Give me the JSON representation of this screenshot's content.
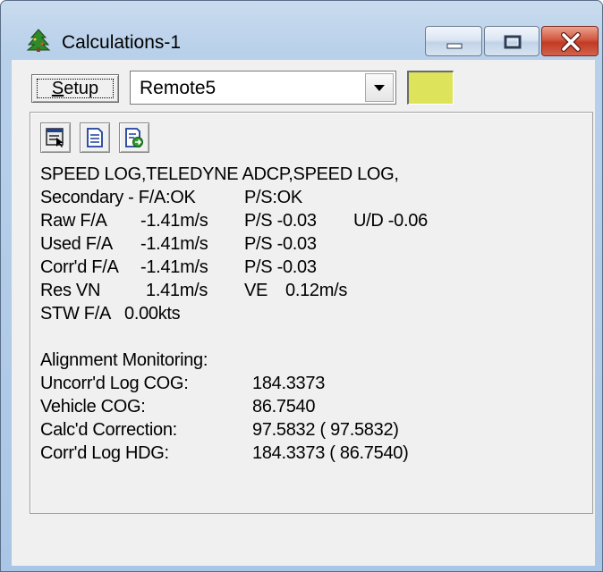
{
  "window": {
    "title": "Calculations-1"
  },
  "toolbar": {
    "setup_label_underlined": "S",
    "setup_label_rest": "etup",
    "source_value": "Remote5",
    "status_color": "#dde35a"
  },
  "panel": {
    "line1": "SPEED LOG,TELEDYNE ADCP,SPEED LOG,",
    "secondary": {
      "label": "Secondary - F/A:OK",
      "ps": "P/S:OK"
    },
    "raw": {
      "fa_label": "Raw F/A",
      "fa_value": "-1.41m/s",
      "ps": "P/S -0.03",
      "ud": "U/D -0.06"
    },
    "used": {
      "fa_label": "Used F/A",
      "fa_value": "-1.41m/s",
      "ps": "P/S -0.03"
    },
    "corrd": {
      "fa_label": "Corr'd F/A",
      "fa_value": "-1.41m/s",
      "ps": "P/S -0.03"
    },
    "res": {
      "label": "Res VN",
      "vn": "1.41m/s",
      "ve_label": "VE",
      "ve": "0.12m/s"
    },
    "stw": {
      "label": "STW F/A",
      "value": "0.00kts"
    },
    "alignment": {
      "heading": "Alignment Monitoring:",
      "rows": [
        {
          "label": "Uncorr'd Log COG:",
          "value": "184.3373"
        },
        {
          "label": "Vehicle COG:",
          "value": "86.7540"
        },
        {
          "label": "Calc'd Correction:",
          "value": "97.5832 ( 97.5832)"
        },
        {
          "label": "Corr'd Log HDG:",
          "value": "184.3373 ( 86.7540)"
        }
      ]
    }
  },
  "icons": {
    "app": "tree-app-icon",
    "tool1": "data-view-icon",
    "tool2": "document-icon",
    "tool3": "export-icon"
  }
}
